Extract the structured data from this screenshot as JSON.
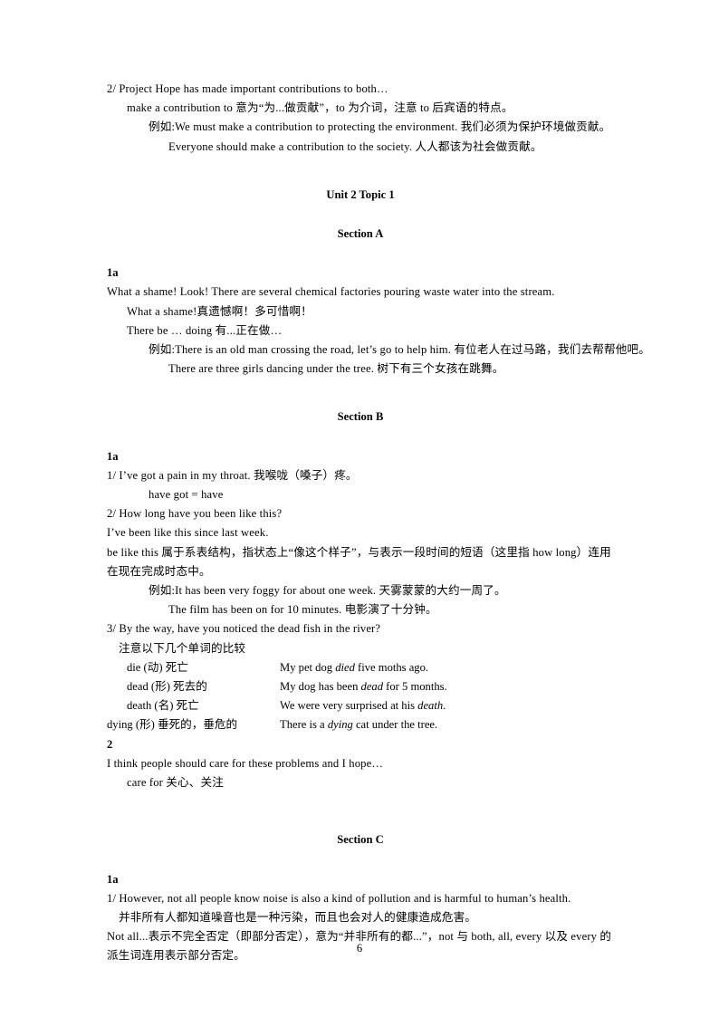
{
  "document": {
    "page_number": "6"
  },
  "top_block": {
    "line1": "2/ Project Hope has made important contributions to both…",
    "line2": "make a contribution to  意为“为...做贡献”，to 为介词，注意 to 后宾语的特点。",
    "line3": "例如:We must make a contribution to protecting the environment.  我们必须为保护环境做贡献。",
    "line4": "Everyone should make a contribution to the society.  人人都该为社会做贡献。"
  },
  "unit_heading": "Unit 2 Topic 1",
  "section_a": {
    "heading": "Section A",
    "label_1a": "1a",
    "line1": "What a shame! Look! There are several chemical factories pouring waste water into the stream.",
    "line2": "What a shame!真遗憾啊！多可惜啊！",
    "line3": "There be … doing  有...正在做…",
    "line4": "例如:There is an old man crossing the road, let’s go to help him.  有位老人在过马路，我们去帮帮他吧。",
    "line5": "There are three girls dancing under the tree.  树下有三个女孩在跳舞。"
  },
  "section_b": {
    "heading": "Section B",
    "label_1a": "1a",
    "line1": "1/ I’ve got a pain in my throat.  我喉咙（嗓子）疼。",
    "line2": "have got = have",
    "line3": "2/ How long have you been like this?",
    "line4": "I’ve been like this since last week.",
    "line5": "be like this 属于系表结构，指状态上“像这个样子”，与表示一段时间的短语（这里指 how long）连用在现在完成时态中。",
    "line6": "例如:It has been very foggy for about one week.  天雾蒙蒙的大约一周了。",
    "line7": "The film has been on for 10 minutes.  电影演了十分钟。",
    "line8": "3/ By the way, have you noticed the dead fish in the river?",
    "line9": "注意以下几个单词的比较",
    "word_table": [
      {
        "word": "die (动) 死亡",
        "example_pre": "My pet dog ",
        "example_italic": "died",
        "example_post": " five moths ago.",
        "indented": true
      },
      {
        "word": "dead (形) 死去的",
        "example_pre": "My dog has been ",
        "example_italic": "dead",
        "example_post": " for 5 months.",
        "indented": true
      },
      {
        "word": "death (名) 死亡",
        "example_pre": "We were very surprised at his ",
        "example_italic": "death",
        "example_post": ".",
        "indented": true
      },
      {
        "word": "dying (形) 垂死的，垂危的",
        "example_pre": "There is a ",
        "example_italic": "dying",
        "example_post": " cat under the tree.",
        "indented": false
      }
    ],
    "label_2": "2",
    "line10": "I think people should care for these problems and I hope…",
    "line11": "care for 关心、关注"
  },
  "section_c": {
    "heading": "Section C",
    "label_1a": "1a",
    "line1": "1/ However, not all people know noise is also a kind of pollution and is harmful to human’s health.",
    "line2": "并非所有人都知道噪音也是一种污染，而且也会对人的健康造成危害。",
    "line3": "Not all...表示不完全否定（即部分否定），意为“并非所有的都...”，not 与 both, all, every 以及 every 的派生词连用表示部分否定。"
  }
}
